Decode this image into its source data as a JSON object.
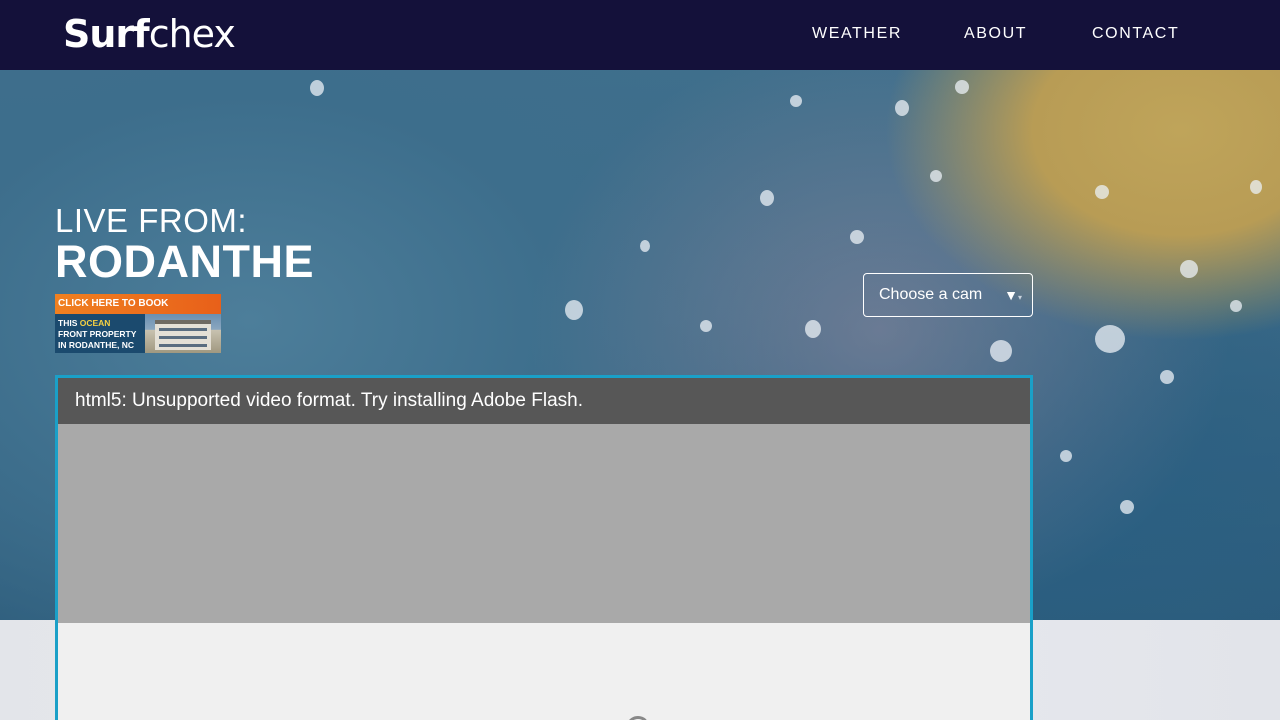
{
  "header": {
    "logo_bold": "Surf",
    "logo_thin": "chex",
    "nav": [
      {
        "label": "WEATHER"
      },
      {
        "label": "ABOUT"
      },
      {
        "label": "CONTACT"
      }
    ]
  },
  "hero": {
    "live_from": "LIVE FROM:",
    "location": "RODANTHE"
  },
  "ad": {
    "headline": "CLICK HERE TO BOOK",
    "line1_prefix": "THIS ",
    "line1_highlight": "OCEAN",
    "line2": "FRONT PROPERTY",
    "line3": "IN RODANTHE, NC"
  },
  "cam_select": {
    "selected": "Choose a cam",
    "arrow": "▼"
  },
  "player": {
    "message": "html5: Unsupported video format. Try installing Adobe Flash."
  },
  "colors": {
    "header_bg": "#14113a",
    "player_border": "#1aa0c8",
    "message_bar": "#575757",
    "video_area": "#a9a9a9"
  }
}
